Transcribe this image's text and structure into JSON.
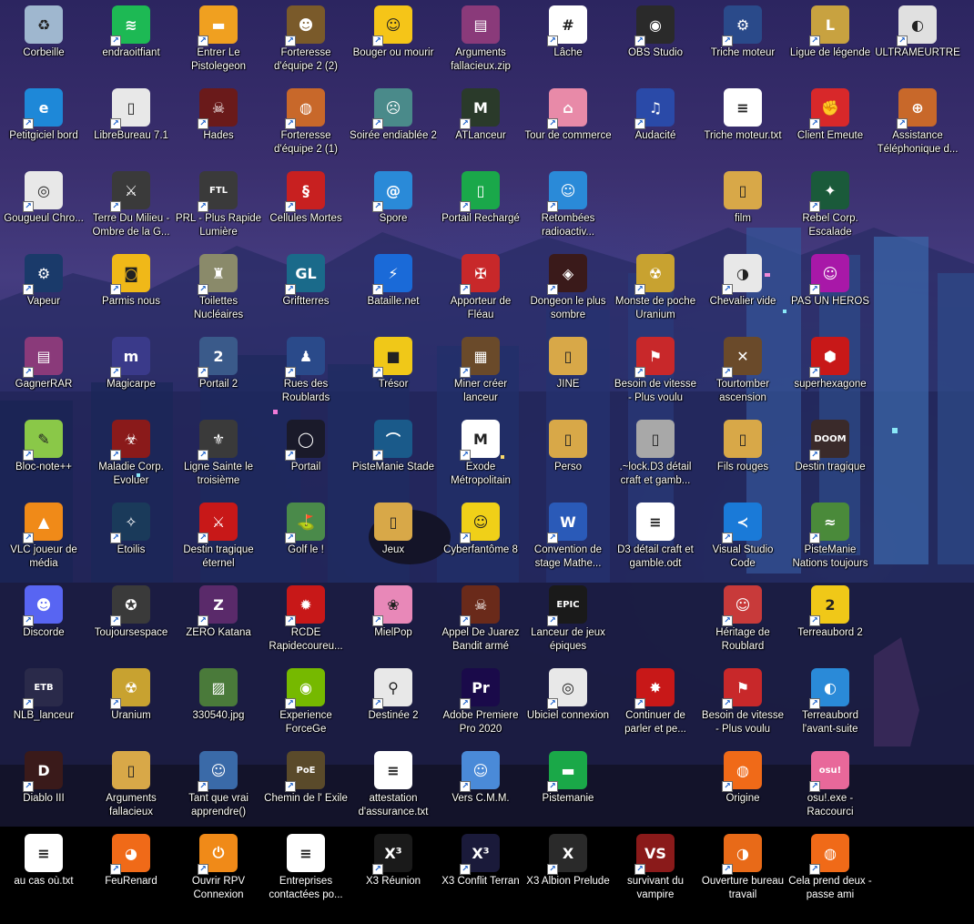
{
  "desktop": {
    "icons": [
      {
        "label": "Corbeille",
        "icon": "recycle-bin-icon",
        "color": "#9fb7cf",
        "sym": "♻",
        "shortcut": false
      },
      {
        "label": "endraoitfiant",
        "icon": "spotify-icon",
        "color": "#1db954",
        "sym": "≋",
        "shortcut": true
      },
      {
        "label": "Entrer Le Pistolegeon",
        "icon": "enter-the-gungeon-icon",
        "color": "#f0a020",
        "sym": "▬",
        "shortcut": true
      },
      {
        "label": "Forteresse d'équipe  2 (2)",
        "icon": "team-fortress-icon",
        "color": "#7a5a2a",
        "sym": "☻",
        "shortcut": true
      },
      {
        "label": "Bouger ou mourir",
        "icon": "move-or-die-icon",
        "color": "#f5c518",
        "sym": "☺",
        "shortcut": true
      },
      {
        "label": "Arguments fallacieux.zip",
        "icon": "winrar-archive-icon",
        "color": "#8a3a7a",
        "sym": "▤",
        "shortcut": false
      },
      {
        "label": "Lâche",
        "icon": "slack-icon",
        "color": "#ffffff",
        "sym": "#",
        "shortcut": true
      },
      {
        "label": "OBS Studio",
        "icon": "obs-icon",
        "color": "#2a2a2a",
        "sym": "◉",
        "shortcut": true
      },
      {
        "label": "Triche moteur",
        "icon": "cheat-engine-icon",
        "color": "#2a4a8a",
        "sym": "⚙",
        "shortcut": true
      },
      {
        "label": "Ligue de légende",
        "icon": "league-of-legends-icon",
        "color": "#c8a240",
        "sym": "L",
        "shortcut": true
      },
      {
        "label": "ULTRAMEURTRE",
        "icon": "ultrakill-icon",
        "color": "#e0e0e0",
        "sym": "◐",
        "shortcut": true
      },
      {
        "label": "Petitgiciel bord",
        "icon": "edge-icon",
        "color": "#1e88d8",
        "sym": "e",
        "shortcut": true
      },
      {
        "label": "LibreBureau 7.1",
        "icon": "libreoffice-icon",
        "color": "#e8e8e8",
        "sym": "▯",
        "shortcut": true
      },
      {
        "label": "Hades",
        "icon": "hades-icon",
        "color": "#6a1a1a",
        "sym": "☠",
        "shortcut": true
      },
      {
        "label": "Forteresse d'équipe  2 (1)",
        "icon": "team-fortress-icon",
        "color": "#c8682a",
        "sym": "◍",
        "shortcut": true
      },
      {
        "label": "Soirée endiablée 2",
        "icon": "party-game-icon",
        "color": "#4a8a8a",
        "sym": "☹",
        "shortcut": true
      },
      {
        "label": "ATLanceur",
        "icon": "atlauncher-icon",
        "color": "#2a3a2a",
        "sym": "M",
        "shortcut": true
      },
      {
        "label": "Tour de commerce",
        "icon": "trade-tower-icon",
        "color": "#e88aa8",
        "sym": "⌂",
        "shortcut": true
      },
      {
        "label": "Audacité",
        "icon": "audacity-icon",
        "color": "#2a4aa8",
        "sym": "♫",
        "shortcut": true
      },
      {
        "label": "Triche moteur.txt",
        "icon": "text-file-icon",
        "color": "#ffffff",
        "sym": "≡",
        "shortcut": false
      },
      {
        "label": "Client Emeute",
        "icon": "riot-client-icon",
        "color": "#d8282a",
        "sym": "✊",
        "shortcut": true
      },
      {
        "label": "Assistance Téléphonique d...",
        "icon": "helpline-icon",
        "color": "#c8682a",
        "sym": "⊕",
        "shortcut": true
      },
      {
        "label": "Gougueul Chro...",
        "icon": "chrome-icon",
        "color": "#e8e8e8",
        "sym": "◎",
        "shortcut": true
      },
      {
        "label": "Terre Du Milieu - Ombre de la G...",
        "icon": "middle-earth-icon",
        "color": "#3a3a3a",
        "sym": "⚔",
        "shortcut": true
      },
      {
        "label": "PRL - Plus Rapide Lumière",
        "icon": "ftl-icon",
        "color": "#3a3a3a",
        "sym": "FTL",
        "shortcut": true
      },
      {
        "label": "Cellules Mortes",
        "icon": "dead-cells-icon",
        "color": "#c82020",
        "sym": "§",
        "shortcut": true
      },
      {
        "label": "Spore",
        "icon": "spore-icon",
        "color": "#2a8ad8",
        "sym": "@",
        "shortcut": true
      },
      {
        "label": "Portail Rechargé",
        "icon": "portal-reloaded-icon",
        "color": "#1aa84a",
        "sym": "▯",
        "shortcut": true
      },
      {
        "label": "Retombées radioactiv...",
        "icon": "fallout-icon",
        "color": "#2a8ad8",
        "sym": "☺",
        "shortcut": true
      },
      {
        "label": "",
        "icon": "",
        "color": "",
        "sym": "",
        "shortcut": false
      },
      {
        "label": "film",
        "icon": "folder-icon",
        "color": "#d8a848",
        "sym": "▯",
        "shortcut": false
      },
      {
        "label": "Rebel Corp. Escalade",
        "icon": "rebel-corp-icon",
        "color": "#1a5a3a",
        "sym": "✦",
        "shortcut": true
      },
      {
        "label": "",
        "icon": "",
        "color": "",
        "sym": "",
        "shortcut": false
      },
      {
        "label": "Vapeur",
        "icon": "steam-icon",
        "color": "#1a3a6a",
        "sym": "⚙",
        "shortcut": true
      },
      {
        "label": "Parmis nous",
        "icon": "among-us-icon",
        "color": "#f0b818",
        "sym": "◙",
        "shortcut": true
      },
      {
        "label": "Toilettes Nucléaires",
        "icon": "nuclear-toilets-icon",
        "color": "#8a8a6a",
        "sym": "♜",
        "shortcut": true
      },
      {
        "label": "Griftterres",
        "icon": "griftlands-icon",
        "color": "#1a6a8a",
        "sym": "GL",
        "shortcut": true
      },
      {
        "label": "Bataille.net",
        "icon": "battle-net-icon",
        "color": "#1a6ad8",
        "sym": "⚡",
        "shortcut": true
      },
      {
        "label": "Apporteur de Fléau",
        "icon": "plague-bringer-icon",
        "color": "#c8282a",
        "sym": "✠",
        "shortcut": true
      },
      {
        "label": "Dongeon le plus sombre",
        "icon": "darkest-dungeon-icon",
        "color": "#3a1a1a",
        "sym": "◈",
        "shortcut": true
      },
      {
        "label": "Monste de poche Uranium",
        "icon": "pokemon-uranium-icon",
        "color": "#c8a230",
        "sym": "☢",
        "shortcut": true
      },
      {
        "label": "Chevalier vide",
        "icon": "hollow-knight-icon",
        "color": "#e8e8e8",
        "sym": "◑",
        "shortcut": true
      },
      {
        "label": "PAS UN HEROS",
        "icon": "not-a-hero-icon",
        "color": "#a818a8",
        "sym": "☺",
        "shortcut": true
      },
      {
        "label": "",
        "icon": "",
        "color": "",
        "sym": "",
        "shortcut": false
      },
      {
        "label": "GagnerRAR",
        "icon": "winrar-icon",
        "color": "#8a3a7a",
        "sym": "▤",
        "shortcut": true
      },
      {
        "label": "Magicarpe",
        "icon": "magikarp-icon",
        "color": "#3a3a8a",
        "sym": "m",
        "shortcut": true
      },
      {
        "label": "Portail 2",
        "icon": "portal-2-icon",
        "color": "#3a5a8a",
        "sym": "2",
        "shortcut": true
      },
      {
        "label": "Rues des Roublards",
        "icon": "streets-of-rogue-icon",
        "color": "#2a4a8a",
        "sym": "♟",
        "shortcut": true
      },
      {
        "label": "Trésor",
        "icon": "treasure-icon",
        "color": "#f0c818",
        "sym": "■",
        "shortcut": true
      },
      {
        "label": "Miner créer lanceur",
        "icon": "minecraft-launcher-icon",
        "color": "#6a4a2a",
        "sym": "▦",
        "shortcut": true
      },
      {
        "label": "JINE",
        "icon": "folder-icon",
        "color": "#d8a848",
        "sym": "▯",
        "shortcut": false
      },
      {
        "label": "Besoin de vitesse - Plus voulu",
        "icon": "need-for-speed-icon",
        "color": "#c8282a",
        "sym": "⚑",
        "shortcut": true
      },
      {
        "label": "Tourtomber ascension",
        "icon": "towerfall-icon",
        "color": "#6a4a2a",
        "sym": "✕",
        "shortcut": true
      },
      {
        "label": "superhexagone",
        "icon": "super-hexagon-icon",
        "color": "#c81818",
        "sym": "⬢",
        "shortcut": true
      },
      {
        "label": "",
        "icon": "",
        "color": "",
        "sym": "",
        "shortcut": false
      },
      {
        "label": "Bloc-note++",
        "icon": "notepad-plus-plus-icon",
        "color": "#8ac848",
        "sym": "✎",
        "shortcut": true
      },
      {
        "label": "Maladie Corp. Evoluer",
        "icon": "plague-inc-icon",
        "color": "#8a1a1a",
        "sym": "☣",
        "shortcut": true
      },
      {
        "label": "Ligne Sainte le troisième",
        "icon": "saints-row-icon",
        "color": "#3a3a3a",
        "sym": "⚜",
        "shortcut": true
      },
      {
        "label": "Portail",
        "icon": "portal-icon",
        "color": "#1a1a2a",
        "sym": "◯",
        "shortcut": true
      },
      {
        "label": "PisteManie Stade",
        "icon": "trackmania-stadium-icon",
        "color": "#1a5a8a",
        "sym": "⌒",
        "shortcut": true
      },
      {
        "label": "Exode Métropolitain",
        "icon": "metro-exodus-icon",
        "color": "#ffffff",
        "sym": "M",
        "shortcut": true
      },
      {
        "label": "Perso",
        "icon": "folder-icon",
        "color": "#d8a848",
        "sym": "▯",
        "shortcut": false
      },
      {
        "label": ".~lock.D3 détail craft et gamb...",
        "icon": "lock-file-icon",
        "color": "#a8a8a8",
        "sym": "▯",
        "shortcut": false
      },
      {
        "label": "Fils rouges",
        "icon": "folder-icon",
        "color": "#d8a848",
        "sym": "▯",
        "shortcut": false
      },
      {
        "label": "Destin tragique",
        "icon": "doom-icon",
        "color": "#3a2a2a",
        "sym": "DOOM",
        "shortcut": true
      },
      {
        "label": "",
        "icon": "",
        "color": "",
        "sym": "",
        "shortcut": false
      },
      {
        "label": "VLC joueur de média",
        "icon": "vlc-icon",
        "color": "#f08a18",
        "sym": "▲",
        "shortcut": true
      },
      {
        "label": "Etoilis",
        "icon": "stellaris-icon",
        "color": "#1a3a5a",
        "sym": "✧",
        "shortcut": true
      },
      {
        "label": "Destin tragique éternel",
        "icon": "doom-eternal-icon",
        "color": "#c81818",
        "sym": "⚔",
        "shortcut": true
      },
      {
        "label": "Golf le !",
        "icon": "golf-it-icon",
        "color": "#4a8a4a",
        "sym": "⛳",
        "shortcut": true
      },
      {
        "label": "Jeux",
        "icon": "folder-icon",
        "color": "#d8a848",
        "sym": "▯",
        "shortcut": false
      },
      {
        "label": "Cyberfantôme 8",
        "icon": "cyberghost-icon",
        "color": "#f0d018",
        "sym": "☺",
        "shortcut": true
      },
      {
        "label": "Convention de stage Mathe...",
        "icon": "word-document-icon",
        "color": "#2a5ab8",
        "sym": "W",
        "shortcut": true
      },
      {
        "label": "D3 détail craft et gamble.odt",
        "icon": "odt-document-icon",
        "color": "#ffffff",
        "sym": "≡",
        "shortcut": false
      },
      {
        "label": "Visual Studio Code",
        "icon": "vscode-icon",
        "color": "#1a7ad8",
        "sym": "≺",
        "shortcut": true
      },
      {
        "label": "PisteManie Nations toujours",
        "icon": "trackmania-nations-icon",
        "color": "#4a8a3a",
        "sym": "≈",
        "shortcut": true
      },
      {
        "label": "",
        "icon": "",
        "color": "",
        "sym": "",
        "shortcut": false
      },
      {
        "label": "Discorde",
        "icon": "discord-icon",
        "color": "#5865f2",
        "sym": "☻",
        "shortcut": true
      },
      {
        "label": "Toujoursespace",
        "icon": "everspace-icon",
        "color": "#3a3a3a",
        "sym": "✪",
        "shortcut": true
      },
      {
        "label": "ZERO Katana",
        "icon": "katana-zero-icon",
        "color": "#5a2a6a",
        "sym": "Z",
        "shortcut": true
      },
      {
        "label": "RCDE Rapidecoureu...",
        "icon": "speedrunners-icon",
        "color": "#c81818",
        "sym": "✹",
        "shortcut": true
      },
      {
        "label": "MielPop",
        "icon": "honeypop-icon",
        "color": "#e888b8",
        "sym": "❀",
        "shortcut": true
      },
      {
        "label": "Appel De Juarez Bandit armé",
        "icon": "call-of-juarez-icon",
        "color": "#6a2a1a",
        "sym": "☠",
        "shortcut": true
      },
      {
        "label": "Lanceur de jeux épiques",
        "icon": "epic-games-icon",
        "color": "#1a1a1a",
        "sym": "EPIC",
        "shortcut": true
      },
      {
        "label": "",
        "icon": "",
        "color": "",
        "sym": "",
        "shortcut": false
      },
      {
        "label": "Héritage de Roublard",
        "icon": "rogue-legacy-icon",
        "color": "#c83a3a",
        "sym": "☺",
        "shortcut": true
      },
      {
        "label": "Terreaubord 2",
        "icon": "borderlands-2-icon",
        "color": "#f0c818",
        "sym": "2",
        "shortcut": true
      },
      {
        "label": "",
        "icon": "",
        "color": "",
        "sym": "",
        "shortcut": false
      },
      {
        "label": "NLB_lanceur",
        "icon": "nlb-launcher-icon",
        "color": "#2a2a4a",
        "sym": "ETB",
        "shortcut": true
      },
      {
        "label": "Uranium",
        "icon": "uranium-icon",
        "color": "#c8a230",
        "sym": "☢",
        "shortcut": true
      },
      {
        "label": "330540.jpg",
        "icon": "image-file-icon",
        "color": "#4a7a3a",
        "sym": "▨",
        "shortcut": false
      },
      {
        "label": "Experience ForceGe",
        "icon": "geforce-experience-icon",
        "color": "#76b900",
        "sym": "◉",
        "shortcut": true
      },
      {
        "label": "Destinée 2",
        "icon": "destiny-2-icon",
        "color": "#e8e8e8",
        "sym": "⚲",
        "shortcut": true
      },
      {
        "label": "Adobe Premiere Pro 2020",
        "icon": "premiere-pro-icon",
        "color": "#1a0a4a",
        "sym": "Pr",
        "shortcut": true
      },
      {
        "label": "Ubiciel connexion",
        "icon": "ubisoft-connect-icon",
        "color": "#e8e8e8",
        "sym": "◎",
        "shortcut": true
      },
      {
        "label": "Continuer de parler et pe...",
        "icon": "keep-talking-icon",
        "color": "#c81818",
        "sym": "✸",
        "shortcut": true
      },
      {
        "label": "Besoin de vitesse - Plus voulu",
        "icon": "need-for-speed-icon",
        "color": "#c8282a",
        "sym": "⚑",
        "shortcut": true
      },
      {
        "label": "Terreaubord l'avant-suite",
        "icon": "borderlands-presequel-icon",
        "color": "#2a8ad8",
        "sym": "◐",
        "shortcut": true
      },
      {
        "label": "",
        "icon": "",
        "color": "",
        "sym": "",
        "shortcut": false
      },
      {
        "label": "Diablo III",
        "icon": "diablo-3-icon",
        "color": "#3a1a1a",
        "sym": "D",
        "shortcut": true
      },
      {
        "label": "Arguments fallacieux",
        "icon": "folder-icon",
        "color": "#d8a848",
        "sym": "▯",
        "shortcut": false
      },
      {
        "label": "Tant que vrai apprendre()",
        "icon": "while-true-learn-icon",
        "color": "#3a6aa8",
        "sym": "☺",
        "shortcut": true
      },
      {
        "label": "Chemin de l' Exile",
        "icon": "path-of-exile-icon",
        "color": "#5a4a2a",
        "sym": "PoE",
        "shortcut": true
      },
      {
        "label": "attestation d'assurance.txt",
        "icon": "text-file-icon",
        "color": "#ffffff",
        "sym": "≡",
        "shortcut": false
      },
      {
        "label": "Vers C.M.M.",
        "icon": "to-the-moon-icon",
        "color": "#4a8ad8",
        "sym": "☺",
        "shortcut": true
      },
      {
        "label": "Pistemanie",
        "icon": "trackmania-icon",
        "color": "#1aa848",
        "sym": "▬",
        "shortcut": true
      },
      {
        "label": "",
        "icon": "",
        "color": "",
        "sym": "",
        "shortcut": false
      },
      {
        "label": "Origine",
        "icon": "origin-icon",
        "color": "#f06a18",
        "sym": "◍",
        "shortcut": true
      },
      {
        "label": "osu!.exe - Raccourci",
        "icon": "osu-icon",
        "color": "#e8689a",
        "sym": "osu!",
        "shortcut": true
      },
      {
        "label": "",
        "icon": "",
        "color": "",
        "sym": "",
        "shortcut": false
      },
      {
        "label": "au cas où.txt",
        "icon": "text-file-icon",
        "color": "#ffffff",
        "sym": "≡",
        "shortcut": false
      },
      {
        "label": "FeuRenard",
        "icon": "firefox-icon",
        "color": "#f06a18",
        "sym": "◕",
        "shortcut": true
      },
      {
        "label": "Ouvrir RPV Connexion",
        "icon": "openvpn-icon",
        "color": "#f08a18",
        "sym": "⏻",
        "shortcut": true
      },
      {
        "label": "Entreprises contactées po...",
        "icon": "text-file-icon",
        "color": "#ffffff",
        "sym": "≡",
        "shortcut": false
      },
      {
        "label": "X3 Réunion",
        "icon": "x3-reunion-icon",
        "color": "#1a1a1a",
        "sym": "X³",
        "shortcut": true
      },
      {
        "label": "X3 Conflit Terran",
        "icon": "x3-terran-conflict-icon",
        "color": "#1a1a3a",
        "sym": "X³",
        "shortcut": true
      },
      {
        "label": "X3 Albion Prelude",
        "icon": "x3-albion-prelude-icon",
        "color": "#2a2a2a",
        "sym": "X",
        "shortcut": true
      },
      {
        "label": "survivant du vampire",
        "icon": "vampire-survivors-icon",
        "color": "#8a1a1a",
        "sym": "VS",
        "shortcut": true
      },
      {
        "label": "Ouverture bureau travail",
        "icon": "open-desktop-icon",
        "color": "#e86a18",
        "sym": "◑",
        "shortcut": true
      },
      {
        "label": "Cela prend deux - passe ami",
        "icon": "it-takes-two-icon",
        "color": "#f06a18",
        "sym": "◍",
        "shortcut": true
      },
      {
        "label": "",
        "icon": "",
        "color": "",
        "sym": "",
        "shortcut": false
      }
    ]
  }
}
